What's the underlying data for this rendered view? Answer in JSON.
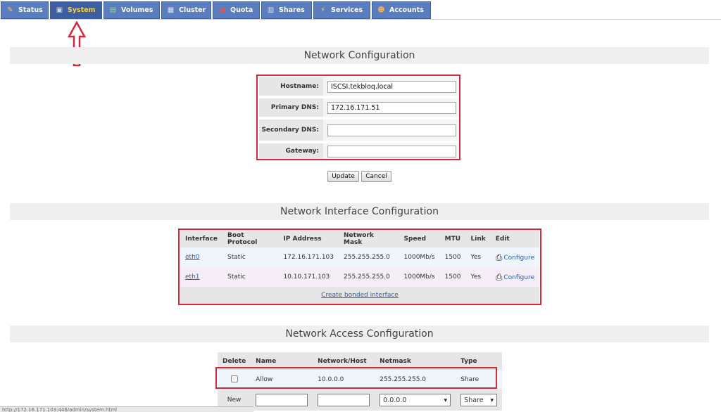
{
  "nav": {
    "tabs": [
      {
        "label": "Status",
        "icon": "status-icon"
      },
      {
        "label": "System",
        "icon": "system-icon",
        "active": true
      },
      {
        "label": "Volumes",
        "icon": "volumes-icon"
      },
      {
        "label": "Cluster",
        "icon": "cluster-icon"
      },
      {
        "label": "Quota",
        "icon": "quota-icon"
      },
      {
        "label": "Shares",
        "icon": "shares-icon"
      },
      {
        "label": "Services",
        "icon": "services-icon"
      },
      {
        "label": "Accounts",
        "icon": "accounts-icon"
      }
    ]
  },
  "network_config": {
    "title": "Network Configuration",
    "fields": [
      {
        "label": "Hostname:",
        "value": "ISCSI.tekbloq.local"
      },
      {
        "label": "Primary DNS:",
        "value": "172.16.171.51"
      },
      {
        "label": "Secondary DNS:",
        "value": ""
      },
      {
        "label": "Gateway:",
        "value": ""
      }
    ],
    "update_label": "Update",
    "cancel_label": "Cancel"
  },
  "interface_config": {
    "title": "Network Interface Configuration",
    "columns": [
      "Interface",
      "Boot Protocol",
      "IP Address",
      "Network Mask",
      "Speed",
      "MTU",
      "Link",
      "Edit"
    ],
    "rows": [
      {
        "interface": "eth0",
        "boot": "Static",
        "ip": "172.16.171.103",
        "mask": "255.255.255.0",
        "speed": "1000Mb/s",
        "mtu": "1500",
        "link": "Yes",
        "edit": "Configure"
      },
      {
        "interface": "eth1",
        "boot": "Static",
        "ip": "10.10.171.103",
        "mask": "255.255.255.0",
        "speed": "1000Mb/s",
        "mtu": "1500",
        "link": "Yes",
        "edit": "Configure"
      }
    ],
    "bond_link": "Create bonded interface"
  },
  "access_config": {
    "title": "Network Access Configuration",
    "columns": [
      "Delete",
      "Name",
      "Network/Host",
      "Netmask",
      "Type"
    ],
    "rows": [
      {
        "name": "Allow",
        "network": "10.0.0.0",
        "netmask": "255.255.255.0",
        "type": "Share"
      }
    ],
    "new_row": {
      "label": "New",
      "netmask": "0.0.0.0",
      "type": "Share"
    }
  },
  "status_bar": "http://172.16.171.103:446/admin/system.html",
  "colors": {
    "tab_bg": "#5a7dbf",
    "highlight": "#d02a3a",
    "link": "#2a5db0"
  }
}
